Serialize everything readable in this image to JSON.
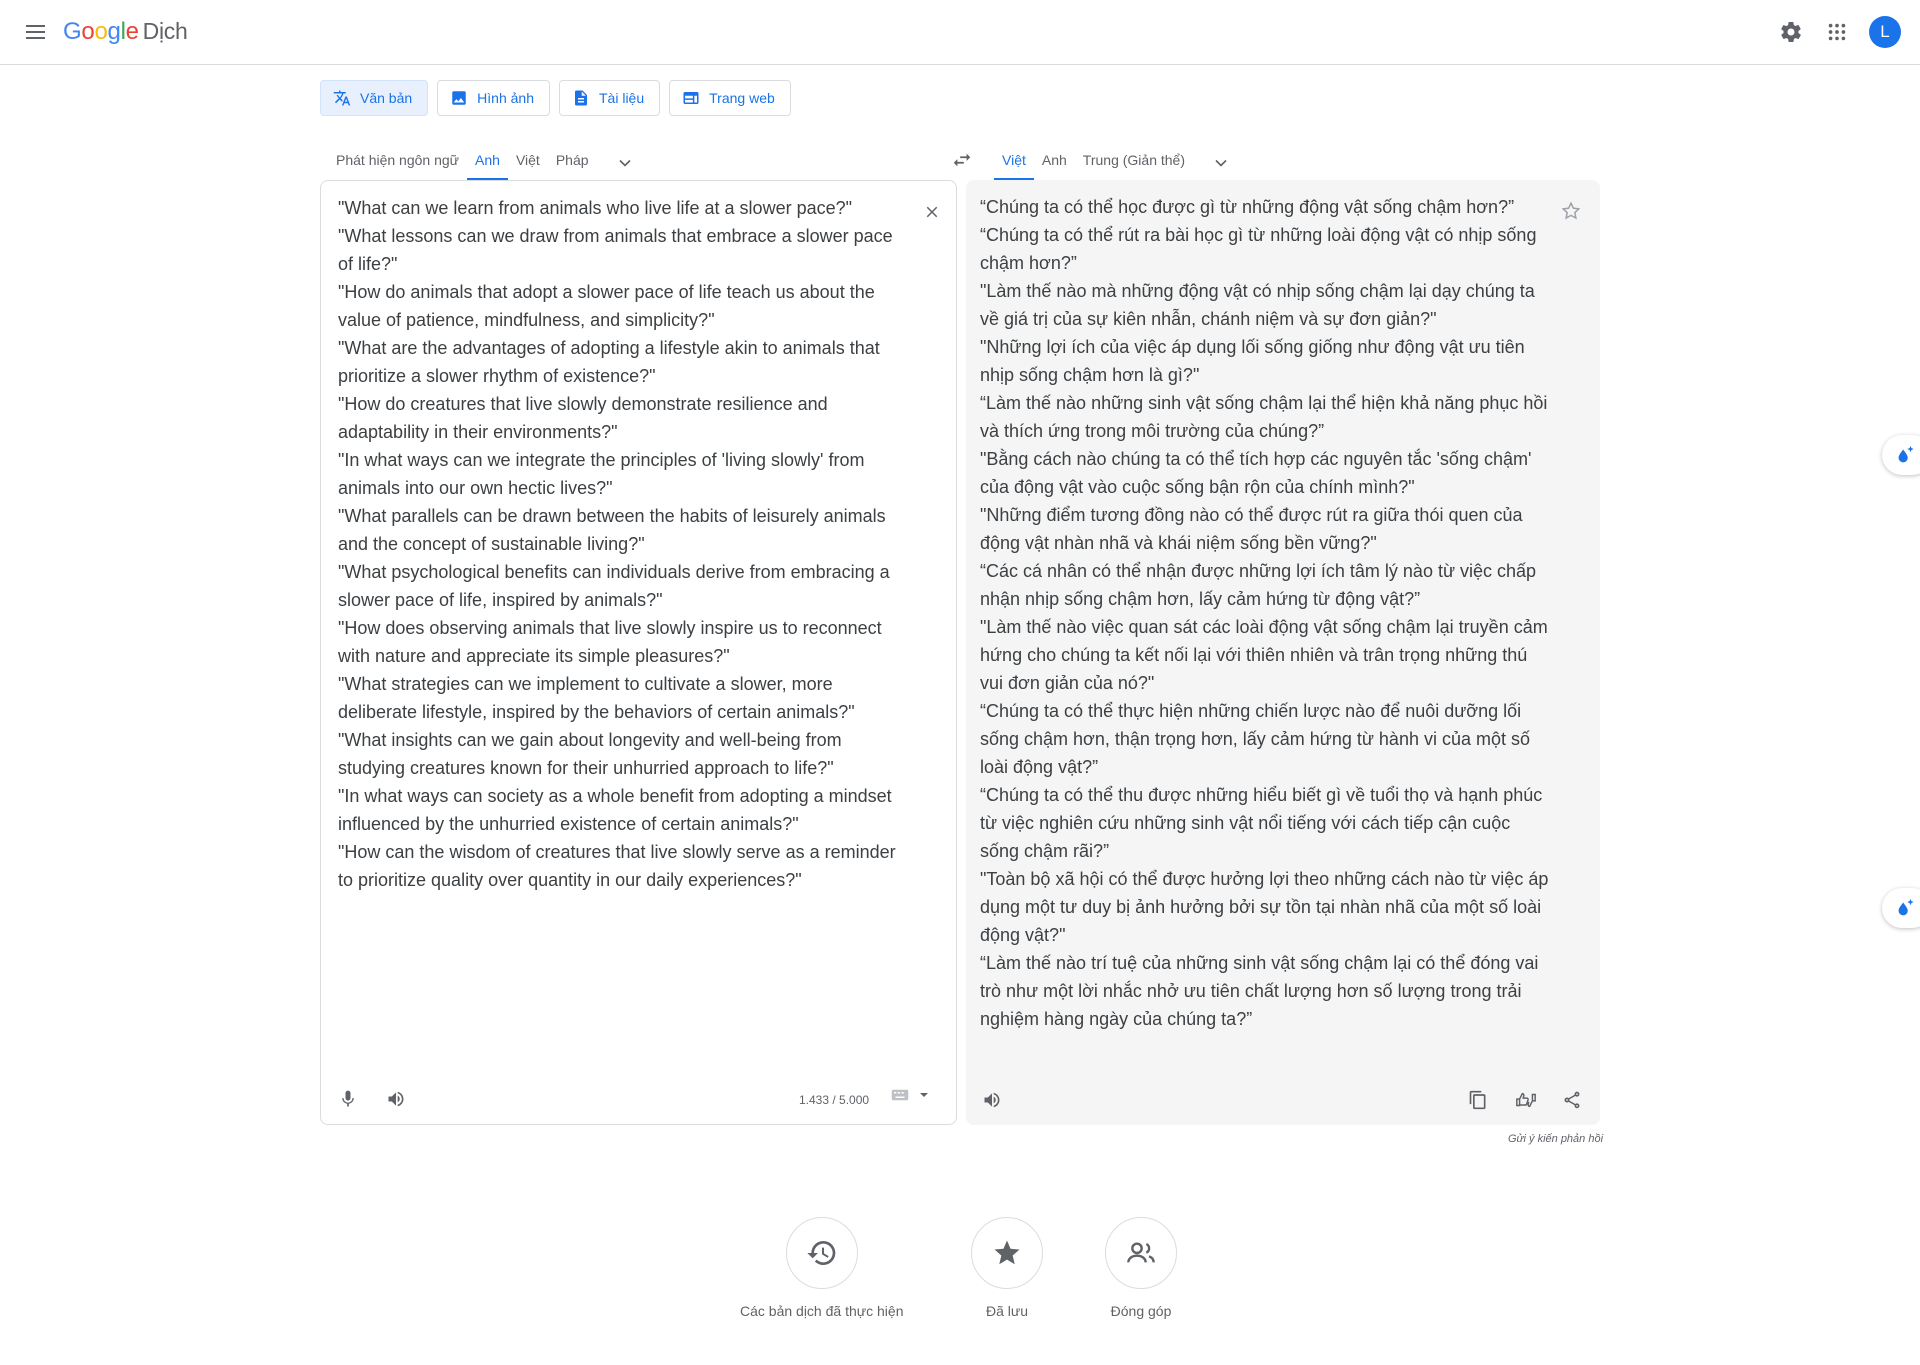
{
  "header": {
    "logo_google": [
      "G",
      "o",
      "o",
      "g",
      "l",
      "e"
    ],
    "product_name": "Dịch",
    "avatar_letter": "L"
  },
  "modes": [
    {
      "label": "Văn bản",
      "icon": "translate-icon",
      "active": true
    },
    {
      "label": "Hình ảnh",
      "icon": "image-icon",
      "active": false
    },
    {
      "label": "Tài liệu",
      "icon": "document-icon",
      "active": false
    },
    {
      "label": "Trang web",
      "icon": "web-icon",
      "active": false
    }
  ],
  "source_langs": {
    "tabs": [
      "Phát hiện ngôn ngữ",
      "Anh",
      "Việt",
      "Pháp"
    ],
    "active": "Anh"
  },
  "target_langs": {
    "tabs": [
      "Việt",
      "Anh",
      "Trung (Giản thể)"
    ],
    "active": "Việt"
  },
  "source": {
    "lines": [
      "\"What can we learn from animals who live life at a slower pace?\"",
      "\"What lessons can we draw from animals that embrace a slower pace",
      "of life?\"",
      "\"How do animals that adopt a slower pace of life teach us about the",
      "value of patience, mindfulness, and simplicity?\"",
      "\"What are the advantages of adopting a lifestyle akin to animals that",
      "prioritize a slower rhythm of existence?\"",
      "\"How do creatures that live slowly demonstrate resilience and",
      "adaptability in their environments?\"",
      "\"In what ways can we integrate the principles of 'living slowly' from",
      "animals into our own hectic lives?\"",
      "\"What parallels can be drawn between the habits of leisurely animals",
      "and the concept of sustainable living?\"",
      "\"What psychological benefits can individuals derive from embracing a",
      "slower pace of life, inspired by animals?\"",
      "\"How does observing animals that live slowly inspire us to reconnect",
      "with nature and appreciate its simple pleasures?\"",
      "\"What strategies can we implement to cultivate a slower, more",
      "deliberate lifestyle, inspired by the behaviors of certain animals?\"",
      "\"What insights can we gain about longevity and well-being from",
      "studying creatures known for their unhurried approach to life?\"",
      "\"In what ways can society as a whole benefit from adopting a mindset",
      "influenced by the unhurried existence of certain animals?\"",
      "\"How can the wisdom of creatures that live slowly serve as a reminder",
      "to prioritize quality over quantity in our daily experiences?\""
    ],
    "char_count": "1.433 / 5.000"
  },
  "target": {
    "lines": [
      "“Chúng ta có thể học được gì từ những động vật sống chậm hơn?”",
      "“Chúng ta có thể rút ra bài học gì từ những loài động vật có nhịp sống",
      "chậm hơn?”",
      "\"Làm thế nào mà những động vật có nhịp sống chậm lại dạy chúng ta",
      "về giá trị của sự kiên nhẫn, chánh niệm và sự đơn giản?\"",
      "\"Những lợi ích của việc áp dụng lối sống giống như động vật ưu tiên",
      "nhịp sống chậm hơn là gì?\"",
      "“Làm thế nào những sinh vật sống chậm lại thể hiện khả năng phục hồi",
      "và thích ứng trong môi trường của chúng?”",
      "\"Bằng cách nào chúng ta có thể tích hợp các nguyên tắc 'sống chậm'",
      "của động vật vào cuộc sống bận rộn của chính mình?\"",
      "\"Những điểm tương đồng nào có thể được rút ra giữa thói quen của",
      "động vật nhàn nhã và khái niệm sống bền vững?\"",
      "“Các cá nhân có thể nhận được những lợi ích tâm lý nào từ việc chấp",
      "nhận nhịp sống chậm hơn, lấy cảm hứng từ động vật?”",
      "\"Làm thế nào việc quan sát các loài động vật sống chậm lại truyền cảm",
      "hứng cho chúng ta kết nối lại với thiên nhiên và trân trọng những thú",
      "vui đơn giản của nó?\"",
      "“Chúng ta có thể thực hiện những chiến lược nào để nuôi dưỡng lối",
      "sống chậm hơn, thận trọng hơn, lấy cảm hứng từ hành vi của một số",
      "loài động vật?”",
      "“Chúng ta có thể thu được những hiểu biết gì về tuổi thọ và hạnh phúc",
      "từ việc nghiên cứu những sinh vật nổi tiếng với cách tiếp cận cuộc",
      "sống chậm rãi?”",
      "\"Toàn bộ xã hội có thể được hưởng lợi theo những cách nào từ việc áp",
      "dụng một tư duy bị ảnh hưởng bởi sự tồn tại nhàn nhã của một số loài",
      "động vật?\"",
      "“Làm thế nào trí tuệ của những sinh vật sống chậm lại có thể đóng vai",
      "trò như một lời nhắc nhở ưu tiên chất lượng hơn số lượng trong trải",
      "nghiệm hàng ngày của chúng ta?”"
    ]
  },
  "feedback": "Gửi ý kiến phản hồi",
  "bottom": [
    {
      "label": "Các bản dịch đã thực hiện",
      "icon": "history-icon"
    },
    {
      "label": "Đã lưu",
      "icon": "star-icon"
    },
    {
      "label": "Đóng góp",
      "icon": "people-icon"
    }
  ],
  "colors": {
    "accent": "#1a73e8",
    "border": "#dadce0",
    "target_bg": "#f5f5f5"
  }
}
